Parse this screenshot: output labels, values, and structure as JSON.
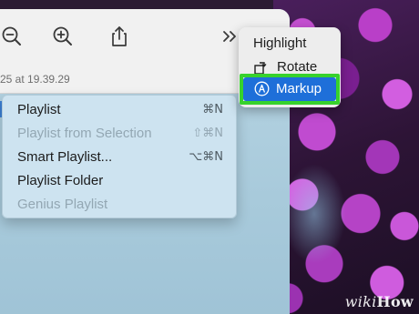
{
  "window": {
    "timestamp": "25 at 19.39.29"
  },
  "toolbar": {
    "buttons": [
      {
        "icon": "zoom-out-icon"
      },
      {
        "icon": "zoom-in-icon"
      },
      {
        "icon": "share-icon"
      },
      {
        "icon": "more-chevrons-icon",
        "label": "»"
      }
    ]
  },
  "overflow_menu": {
    "items": [
      {
        "label": "Highlight",
        "icon": null
      },
      {
        "label": "Rotate",
        "icon": "rotate-icon"
      },
      {
        "label": "Markup",
        "icon": "markup-icon",
        "selected": true
      }
    ]
  },
  "playlist_menu": {
    "items": [
      {
        "label": "Playlist",
        "shortcut": "⌘N",
        "enabled": true
      },
      {
        "label": "Playlist from Selection",
        "shortcut": "⇧⌘N",
        "enabled": false
      },
      {
        "label": "Smart Playlist...",
        "shortcut": "⌥⌘N",
        "enabled": true
      },
      {
        "label": "Playlist Folder",
        "shortcut": "",
        "enabled": true
      },
      {
        "label": "Genius Playlist",
        "shortcut": "",
        "enabled": false
      }
    ]
  },
  "watermark": {
    "part_a": "wiki",
    "part_b": "How"
  },
  "colors": {
    "selection_blue": "#1e6fd9",
    "callout_green": "#37d22c",
    "menu_bg": "#cee4f0"
  }
}
